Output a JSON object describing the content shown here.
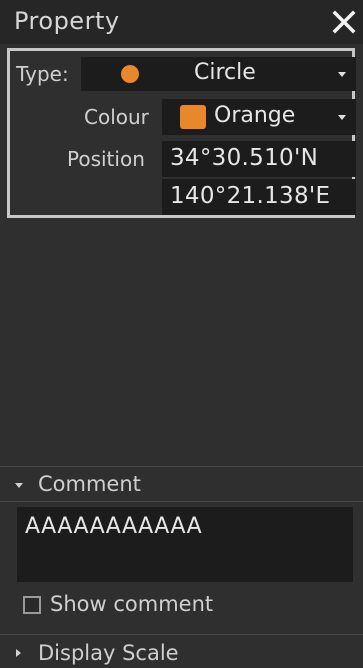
{
  "panel": {
    "title": "Property",
    "close_icon": "close-icon"
  },
  "properties": {
    "type_label": "Type:",
    "type_value": "Circle",
    "type_icon": "circle-icon",
    "type_icon_color": "#e8882a",
    "colour_label": "Colour",
    "colour_value": "Orange",
    "colour_swatch": "#e8882a",
    "position_label": "Position",
    "latitude": "34°30.510'N",
    "longitude": "140°21.138'E"
  },
  "comment": {
    "section_label": "Comment",
    "expanded": true,
    "text": "AAAAAAAAAAA",
    "show_comment_label": "Show comment",
    "show_comment_checked": false
  },
  "display_scale": {
    "section_label": "Display Scale",
    "expanded": false
  }
}
